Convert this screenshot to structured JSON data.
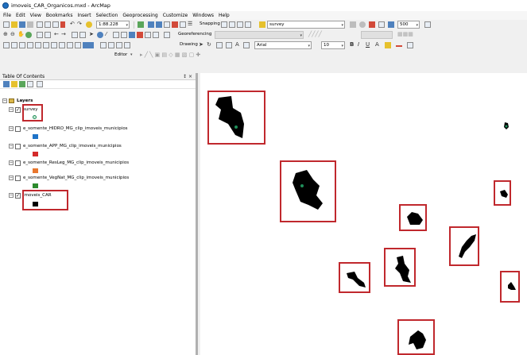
{
  "window": {
    "title": "imoveis_CAR_Organicos.mxd - ArcMap",
    "app_icon": "arcmap-globe-icon"
  },
  "menu": [
    "File",
    "Edit",
    "View",
    "Bookmarks",
    "Insert",
    "Selection",
    "Geoprocessing",
    "Customize",
    "Windows",
    "Help"
  ],
  "toolbars": {
    "scale_value": "1:88.228",
    "snapping_label": "Snapping",
    "layer_select_value": "survey",
    "measure_value": "500",
    "georeferencing_label": "Georeferencing",
    "drawing_label": "Drawing",
    "font_name": "Arial",
    "font_size": "10",
    "bold_label": "B",
    "italic_label": "I",
    "underline_label": "U",
    "editor_label": "Editor"
  },
  "toc": {
    "title": "Table Of Contents",
    "header_buttons": "↕ ×",
    "group_label": "Layers",
    "layers": [
      {
        "name": "survey",
        "checked": true,
        "symbol_color": "#1f8f5a",
        "symbol": "point"
      },
      {
        "name": "e_somente_HIDRO_MG_clip_imoveis_municipios",
        "checked": false,
        "symbol_color": "#1e73c8"
      },
      {
        "name": "e_somente_APP_MG_clip_imoveis_municipios",
        "checked": false,
        "symbol_color": "#d42a2a"
      },
      {
        "name": "e_somente_ResLeg_MG_clip_imoveis_municipios",
        "checked": false,
        "symbol_color": "#e8772e"
      },
      {
        "name": "e_somente_VegNat_MG_clip_imoveis_municipios",
        "checked": false,
        "symbol_color": "#2d8a2d"
      },
      {
        "name": "Imoveis_CAR",
        "checked": true,
        "symbol_color": "#000000"
      }
    ]
  },
  "map": {
    "highlight_color": "#c0282d",
    "polygon_color": "#000000",
    "point_color": "#1f8f5a",
    "parcel_count": 11
  }
}
